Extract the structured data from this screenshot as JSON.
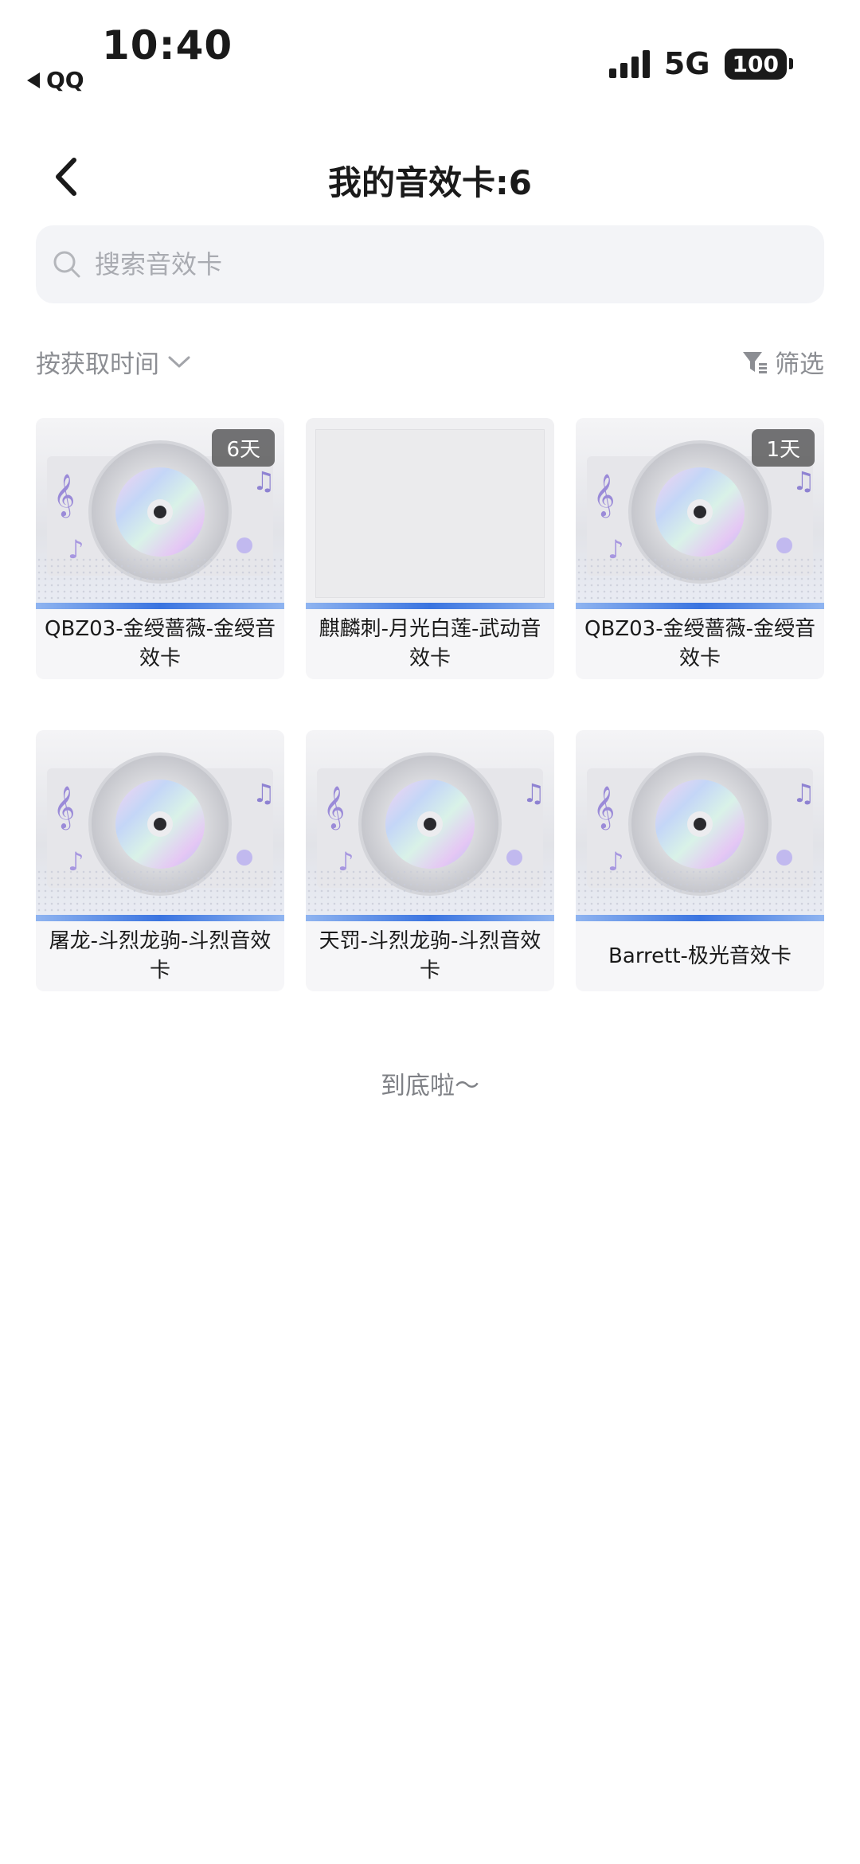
{
  "status": {
    "time": "10:40",
    "back_app": "QQ",
    "network": "5G",
    "battery": "100"
  },
  "header": {
    "title": "我的音效卡:6",
    "back_icon": "chevron-left-icon"
  },
  "search": {
    "placeholder": "搜索音效卡",
    "icon": "search-icon"
  },
  "sort": {
    "label": "按获取时间",
    "icon": "chevron-down-icon"
  },
  "filter": {
    "label": "筛选",
    "icon": "filter-icon"
  },
  "cards": [
    {
      "name": "QBZ03-金绶蔷薇-金绶音效卡",
      "badge": "6天",
      "cover": "cd"
    },
    {
      "name": "麒麟刺-月光白莲-武动音效卡",
      "badge": "",
      "cover": "blank"
    },
    {
      "name": "QBZ03-金绶蔷薇-金绶音效卡",
      "badge": "1天",
      "cover": "cd"
    },
    {
      "name": "屠龙-斗烈龙驹-斗烈音效卡",
      "badge": "",
      "cover": "cd"
    },
    {
      "name": "天罚-斗烈龙驹-斗烈音效卡",
      "badge": "",
      "cover": "cd"
    },
    {
      "name": "Barrett-极光音效卡",
      "badge": "",
      "cover": "cd"
    }
  ],
  "footer": {
    "end_tip": "到底啦～"
  },
  "colors": {
    "accent_strip": "#3a74e0",
    "text_primary": "#1a1a1a",
    "text_secondary": "#8c8e93",
    "search_bg": "#f3f4f7"
  }
}
